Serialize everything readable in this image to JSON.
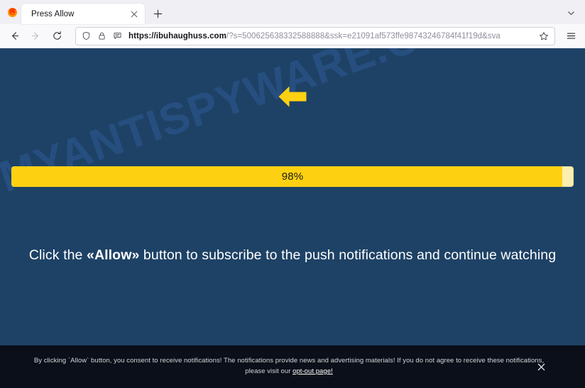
{
  "browser": {
    "app_icon": "firefox-logo-icon",
    "tab": {
      "title": "Press Allow",
      "close_icon": "close-icon"
    },
    "new_tab_icon": "plus-icon",
    "list_all_tabs_icon": "chevron-down-icon",
    "nav": {
      "back_icon": "back-arrow-icon",
      "forward_icon": "forward-arrow-icon",
      "reload_icon": "reload-icon"
    },
    "urlbar": {
      "shield_icon": "shield-icon",
      "lock_icon": "lock-icon",
      "reader_icon": "reader-view-icon",
      "url_scheme_host": "https://ibuhaughuss.com",
      "url_path_query": "/?s=500625638332588888&ssk=e21091af573ffe98743246784f41f19d&sva",
      "bookmark_icon": "star-icon"
    },
    "menu_icon": "hamburger-menu-icon"
  },
  "page": {
    "watermark": "MYANTISPYWARE.COM",
    "arrow_icon": "left-arrow-icon",
    "progress": {
      "value": 98,
      "label": "98%",
      "fill_color": "#fdd112",
      "track_color": "#fbeeae"
    },
    "cta": {
      "before": "Click the ",
      "highlight": "«Allow»",
      "after": " button to subscribe to the push notifications and continue watching"
    },
    "background_color": "#1e4266"
  },
  "consent_banner": {
    "text_part1": "By clicking `Allow` button, you consent to receive notifications! The notifications provide news and advertising materials! If you do not agree to receive these notifications, please visit our ",
    "link_text": "opt-out page!",
    "close_icon": "close-icon",
    "background_color": "#0a0f19"
  }
}
